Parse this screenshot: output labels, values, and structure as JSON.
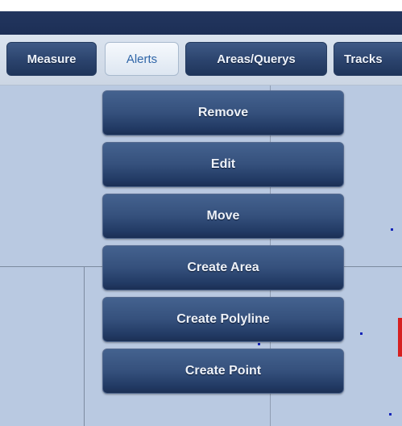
{
  "toolbar": {
    "tabs": [
      {
        "label": "Measure",
        "active": false
      },
      {
        "label": "Alerts",
        "active": true
      },
      {
        "label": "Areas/Querys",
        "active": false
      },
      {
        "label": "Tracks",
        "active": false
      }
    ]
  },
  "menu": {
    "items": [
      {
        "label": "Remove"
      },
      {
        "label": "Edit"
      },
      {
        "label": "Move"
      },
      {
        "label": "Create Area"
      },
      {
        "label": "Create Polyline"
      },
      {
        "label": "Create Point"
      }
    ]
  },
  "colors": {
    "titlebar": "#1d2f56",
    "toolbar": "#d3dce8",
    "button": "#2b436d",
    "active_tab_text": "#3066a8",
    "map_background": "#b9c9e1",
    "map_point": "#1424b8",
    "map_marker": "#d62020"
  }
}
